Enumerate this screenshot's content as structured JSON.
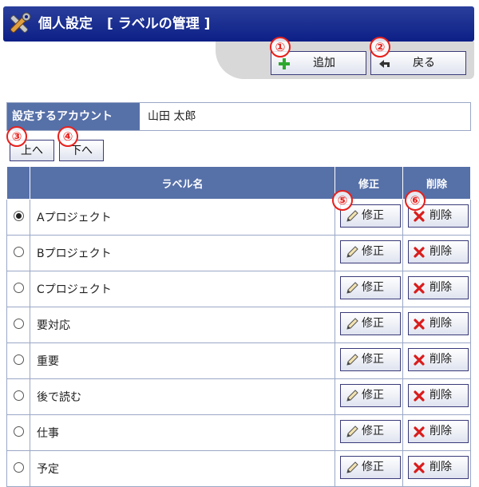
{
  "header": {
    "title": "個人設定",
    "subtitle": "[ ラベルの管理 ]",
    "icon": "tools-icon"
  },
  "toolbar": {
    "add_label": "追加",
    "back_label": "戻る"
  },
  "annotations": [
    "①",
    "②",
    "③",
    "④",
    "⑤",
    "⑥"
  ],
  "account": {
    "label": "設定するアカウント",
    "value": "山田 太郎"
  },
  "move": {
    "up_label": "上へ",
    "down_label": "下へ"
  },
  "table": {
    "headers": {
      "select": "",
      "name": "ラベル名",
      "edit": "修正",
      "delete": "削除"
    },
    "edit_label": "修正",
    "delete_label": "削除",
    "rows": [
      {
        "name": "Aプロジェクト",
        "selected": true
      },
      {
        "name": "Bプロジェクト",
        "selected": false
      },
      {
        "name": "Cプロジェクト",
        "selected": false
      },
      {
        "name": "要対応",
        "selected": false
      },
      {
        "name": "重要",
        "selected": false
      },
      {
        "name": "後で読む",
        "selected": false
      },
      {
        "name": "仕事",
        "selected": false
      },
      {
        "name": "予定",
        "selected": false
      }
    ]
  },
  "colors": {
    "header": "#0d1f86",
    "table_header": "#5670a8",
    "annotation": "#e8201c"
  }
}
